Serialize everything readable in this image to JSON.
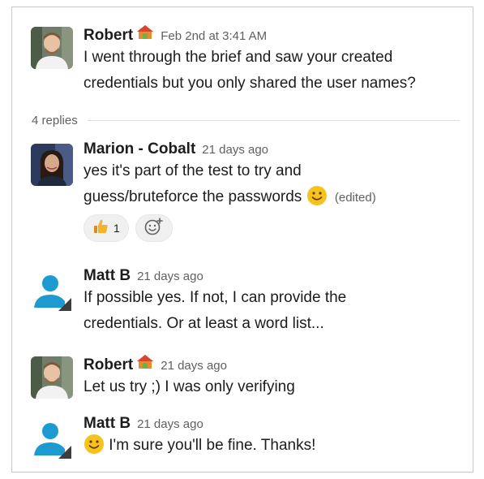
{
  "thread": {
    "parent": {
      "author": "Robert",
      "time": "Feb 2nd at 3:41 AM",
      "line1": "I went through the brief and saw your created",
      "line2": "credentials but you only shared the user names?"
    },
    "replies_label": "4 replies",
    "replies": [
      {
        "author": "Marion - Cobalt",
        "time": "21 days ago",
        "line1": "yes it's part of the test to try and",
        "line2": "guess/bruteforce the passwords",
        "edited": "(edited)",
        "reaction": {
          "icon": "thumbs-up-icon",
          "count": "1"
        }
      },
      {
        "author": "Matt B",
        "time": "21 days ago",
        "line1": "If possible yes. If not, I can provide the",
        "line2": "credentials. Or at least a word list..."
      },
      {
        "author": "Robert",
        "time": "21 days ago",
        "line1": "Let us try ;) I was only verifying"
      },
      {
        "author": "Matt B",
        "time": "21 days ago",
        "line1": "I'm sure you'll be fine. Thanks!"
      }
    ]
  },
  "colors": {
    "text": "#1d1c1d",
    "muted": "#616061",
    "avatar_blue": "#1d9bd1",
    "emoji_yellow": "#f7c21b"
  }
}
